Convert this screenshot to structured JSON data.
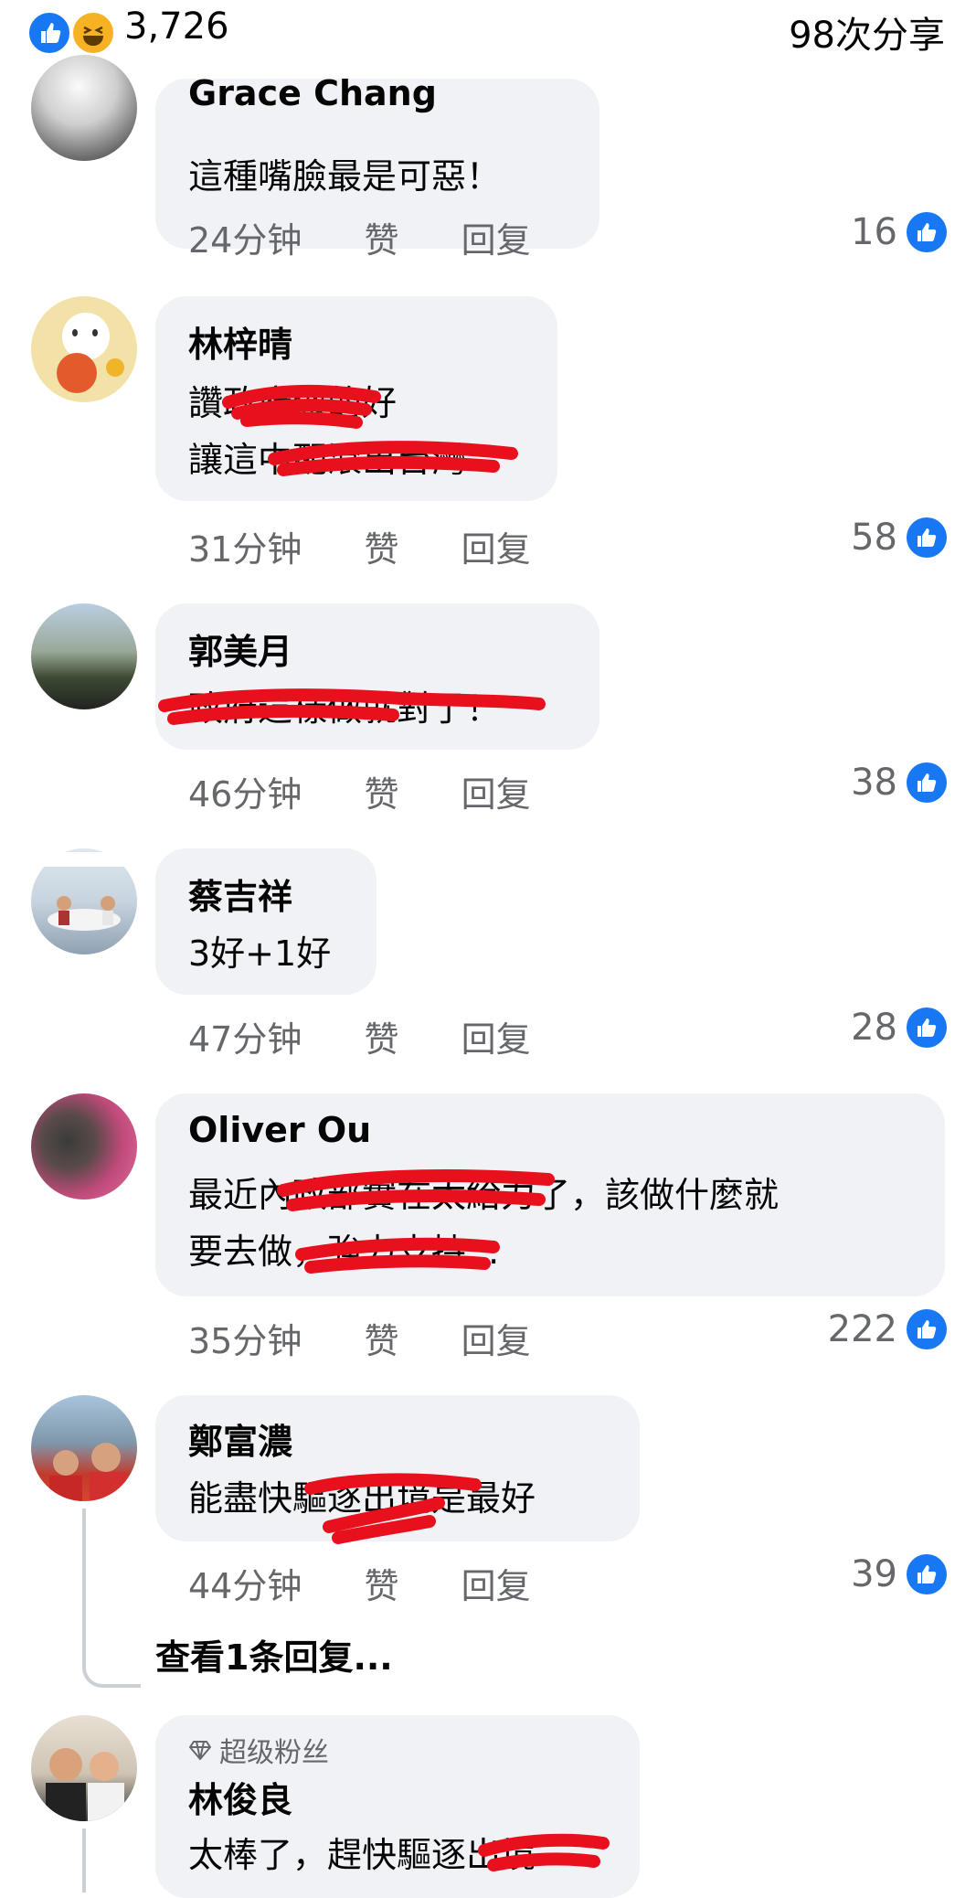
{
  "header": {
    "reaction_count": "3,726",
    "share_count": "98次分享"
  },
  "labels": {
    "like": "赞",
    "reply": "回复"
  },
  "comments": [
    {
      "name": "Grace Chang",
      "lines": [
        "這種嘴臉最是可惡！"
      ],
      "time": "24分钟",
      "likes": "16"
    },
    {
      "name": "林梓晴",
      "lines": [
        "讚政府做的好",
        "讓這中配滾出台灣"
      ],
      "time": "31分钟",
      "likes": "58"
    },
    {
      "name": "郭美月",
      "lines": [
        "政府這樣做就對了！"
      ],
      "time": "46分钟",
      "likes": "38"
    },
    {
      "name": "蔡吉祥",
      "lines": [
        "3好+1好"
      ],
      "time": "47分钟",
      "likes": "28"
    },
    {
      "name": "Oliver Ou",
      "lines": [
        "最近內政部實在太給力了，該做什麼就",
        "要去做，強力支持..."
      ],
      "time": "35分钟",
      "likes": "222"
    },
    {
      "name": "鄭富濃",
      "lines": [
        "能盡快驅逐出境是最好"
      ],
      "time": "44分钟",
      "likes": "39",
      "replies_label": "查看1条回复..."
    },
    {
      "badge": "超级粉丝",
      "name": "林俊良",
      "lines": [
        "太棒了，趕快驅逐出境"
      ]
    }
  ],
  "colors": {
    "facebook_blue": "#1877f2",
    "bubble_bg": "#f0f2f5",
    "secondary_text": "#65676b",
    "scribble_red": "#e8101c"
  }
}
